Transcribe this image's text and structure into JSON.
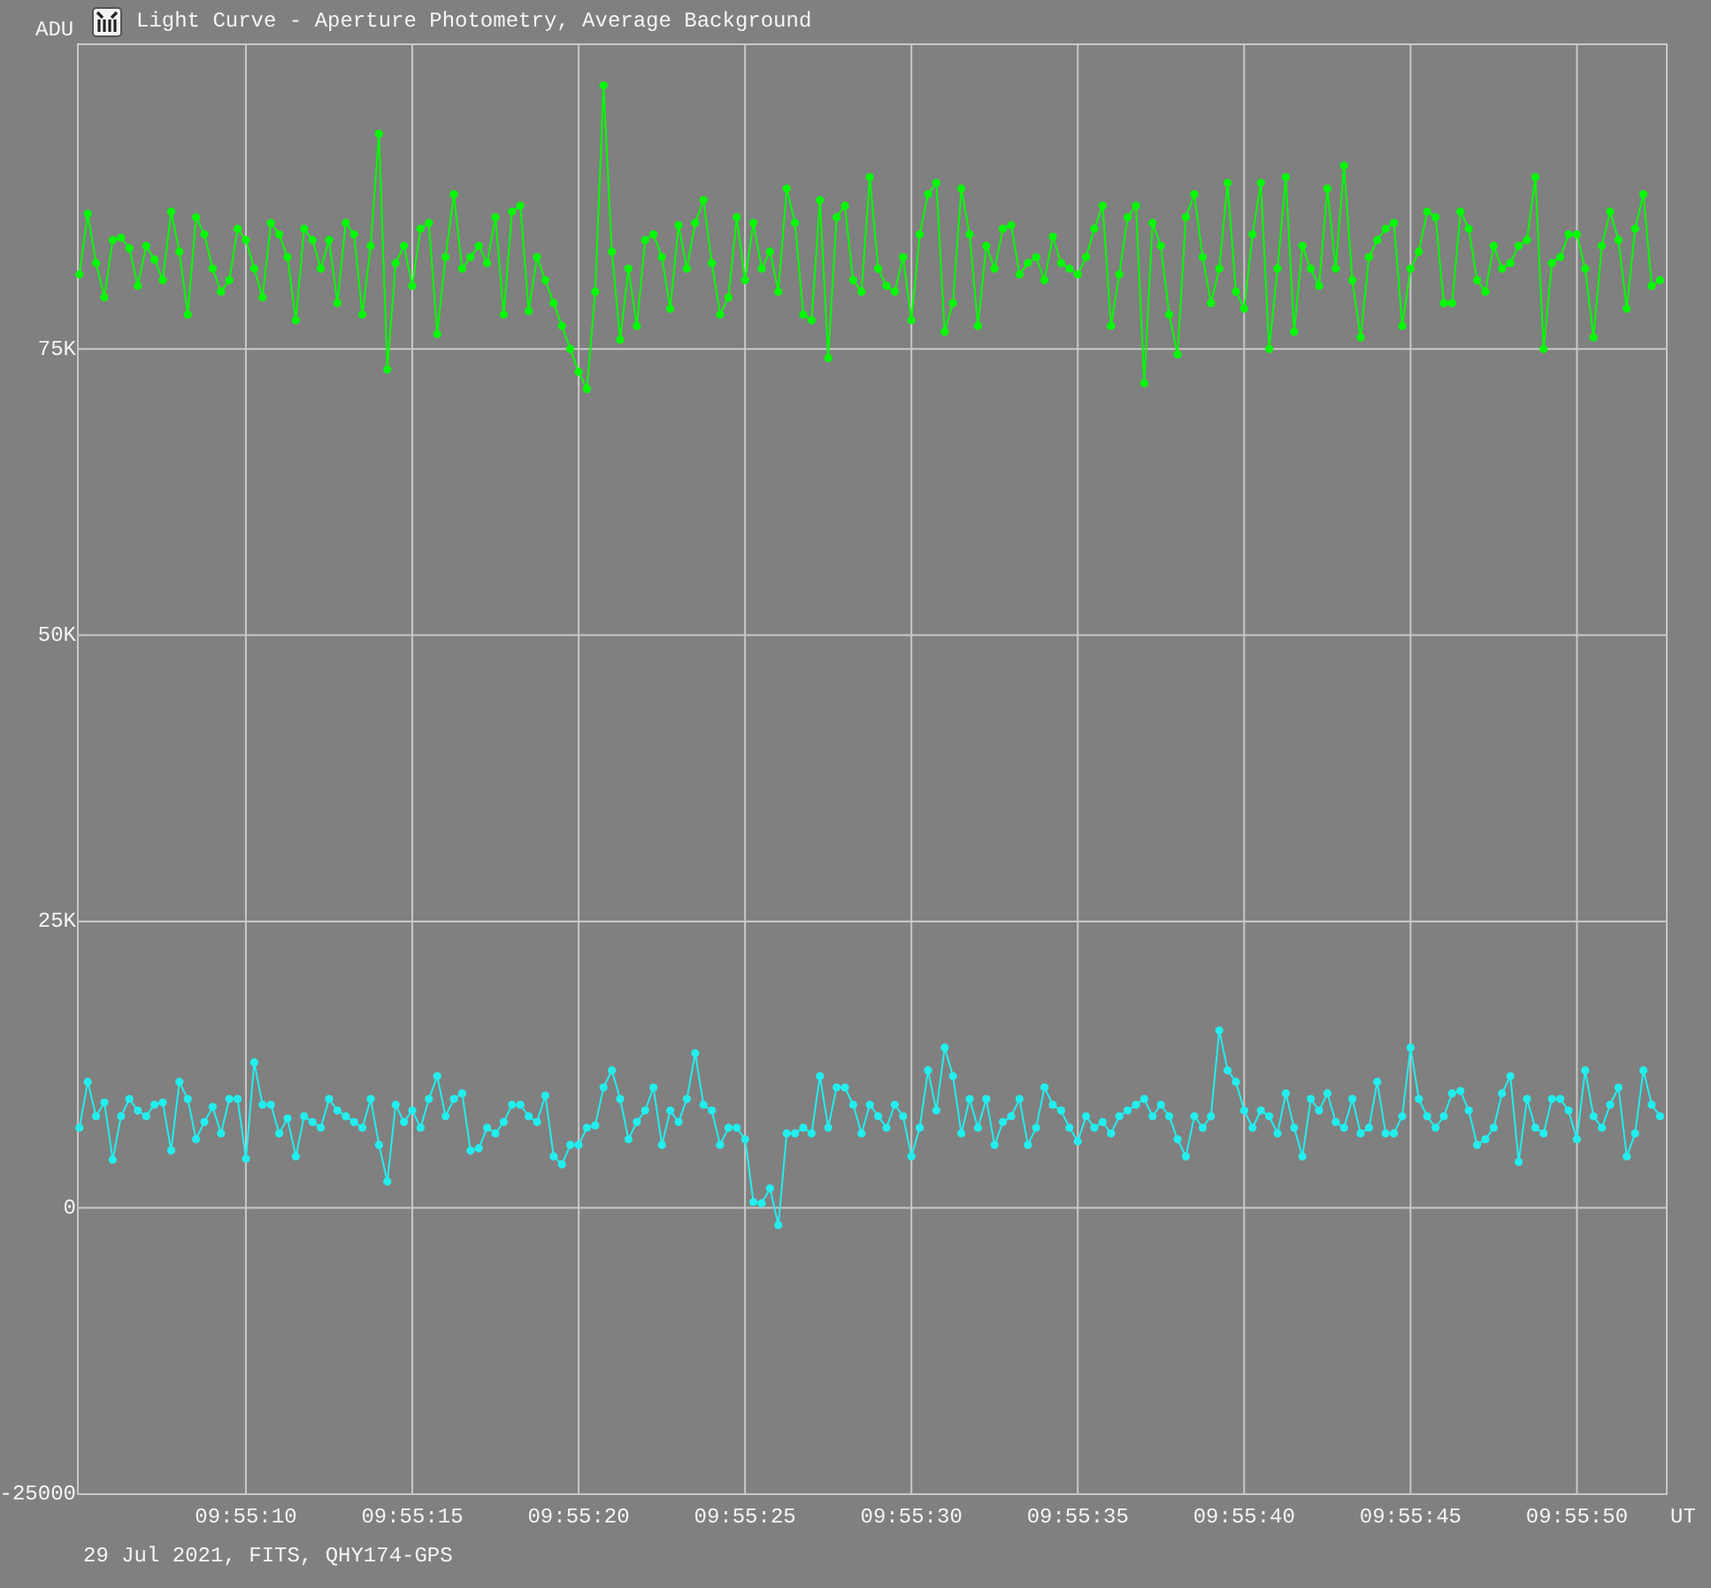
{
  "window": {
    "title": "Light Curve - Aperture Photometry, Average Background"
  },
  "chart": {
    "chart_data": {
      "type": "line",
      "ylabel": "ADU",
      "xlabel": "UT",
      "x": [
        35705,
        35705.25,
        35705.5,
        35705.75,
        35706,
        35706.25,
        35706.5,
        35706.75,
        35707,
        35707.25,
        35707.5,
        35707.75,
        35708,
        35708.25,
        35708.5,
        35708.75,
        35709,
        35709.25,
        35709.5,
        35709.75,
        35710,
        35710.25,
        35710.5,
        35710.75,
        35711,
        35711.25,
        35711.5,
        35711.75,
        35712,
        35712.25,
        35712.5,
        35712.75,
        35713,
        35713.25,
        35713.5,
        35713.75,
        35714,
        35714.25,
        35714.5,
        35714.75,
        35715,
        35715.25,
        35715.5,
        35715.75,
        35716,
        35716.25,
        35716.5,
        35716.75,
        35717,
        35717.25,
        35717.5,
        35717.75,
        35718,
        35718.25,
        35718.5,
        35718.75,
        35719,
        35719.25,
        35719.5,
        35719.75,
        35720,
        35720.25,
        35720.5,
        35720.75,
        35721,
        35721.25,
        35721.5,
        35721.75,
        35722,
        35722.25,
        35722.5,
        35722.75,
        35723,
        35723.25,
        35723.5,
        35723.75,
        35724,
        35724.25,
        35724.5,
        35724.75,
        35725,
        35725.25,
        35725.5,
        35725.75,
        35726,
        35726.25,
        35726.5,
        35726.75,
        35727,
        35727.25,
        35727.5,
        35727.75,
        35728,
        35728.25,
        35728.5,
        35728.75,
        35729,
        35729.25,
        35729.5,
        35729.75,
        35730,
        35730.25,
        35730.5,
        35730.75,
        35731,
        35731.25,
        35731.5,
        35731.75,
        35732,
        35732.25,
        35732.5,
        35732.75,
        35733,
        35733.25,
        35733.5,
        35733.75,
        35734,
        35734.25,
        35734.5,
        35734.75,
        35735,
        35735.25,
        35735.5,
        35735.75,
        35736,
        35736.25,
        35736.5,
        35736.75,
        35737,
        35737.25,
        35737.5,
        35737.75,
        35738,
        35738.25,
        35738.5,
        35738.75,
        35739,
        35739.25,
        35739.5,
        35739.75,
        35740,
        35740.25,
        35740.5,
        35740.75,
        35741,
        35741.25,
        35741.5,
        35741.75,
        35742,
        35742.25,
        35742.5,
        35742.75,
        35743,
        35743.25,
        35743.5,
        35743.75,
        35744,
        35744.25,
        35744.5,
        35744.75,
        35745,
        35745.25,
        35745.5,
        35745.75,
        35746,
        35746.25,
        35746.5,
        35746.75,
        35747,
        35747.25,
        35747.5,
        35747.75,
        35748,
        35748.25,
        35748.5,
        35748.75,
        35749,
        35749.25,
        35749.5,
        35749.75,
        35750,
        35750.25,
        35750.5,
        35750.75,
        35751,
        35751.25,
        35751.5,
        35751.75,
        35752,
        35752.25,
        35752.5
      ],
      "series": [
        {
          "color": "#00ff00",
          "marker": "circle",
          "values": [
            81500,
            86800,
            82500,
            79500,
            84500,
            84700,
            83800,
            80500,
            84000,
            82800,
            81000,
            87000,
            83500,
            78000,
            86500,
            85000,
            82000,
            80000,
            81000,
            85500,
            84500,
            82000,
            79500,
            86000,
            85000,
            83000,
            77500,
            85500,
            84500,
            82000,
            84500,
            79000,
            86000,
            85000,
            78000,
            84000,
            93800,
            73200,
            82500,
            84000,
            80500,
            85500,
            86000,
            76300,
            83000,
            88500,
            82000,
            83000,
            84000,
            82500,
            86500,
            78000,
            87000,
            87500,
            78300,
            83000,
            81000,
            79000,
            77000,
            75000,
            73000,
            71500,
            80000,
            98000,
            83500,
            75800,
            82000,
            77000,
            84500,
            85000,
            83000,
            78500,
            85800,
            82000,
            86000,
            88000,
            82500,
            78000,
            79500,
            86500,
            81000,
            86000,
            82000,
            83500,
            80000,
            89000,
            86000,
            78000,
            77500,
            88000,
            74200,
            86500,
            87500,
            81000,
            80000,
            90000,
            82000,
            80500,
            80000,
            83000,
            77500,
            85000,
            88500,
            89500,
            76500,
            79000,
            89000,
            85000,
            77000,
            84000,
            82000,
            85500,
            85800,
            81500,
            82500,
            83000,
            81000,
            84800,
            82500,
            82000,
            81500,
            83000,
            85500,
            87500,
            77000,
            81500,
            86500,
            87500,
            72000,
            86000,
            84000,
            78000,
            74500,
            86500,
            88500,
            83000,
            79000,
            82000,
            89500,
            80000,
            78500,
            85000,
            89500,
            75000,
            82000,
            90000,
            76500,
            84000,
            82000,
            80500,
            89000,
            82000,
            91000,
            81000,
            76000,
            83000,
            84500,
            85500,
            86000,
            77000,
            82000,
            83500,
            87000,
            86500,
            79000,
            79000,
            87000,
            85500,
            81000,
            80000,
            84000,
            82000,
            82500,
            84000,
            84500,
            90000,
            75000,
            82500,
            83000,
            85000,
            85000,
            82000,
            76000,
            84000,
            87000,
            84500,
            78500,
            85500,
            88500,
            80500,
            81000
          ]
        },
        {
          "color": "#22eeee",
          "marker": "circle",
          "values": [
            7000,
            11000,
            8000,
            9200,
            4200,
            8000,
            9500,
            8500,
            8000,
            9000,
            9200,
            5000,
            11000,
            9500,
            6000,
            7500,
            8800,
            6500,
            9500,
            9500,
            4300,
            12700,
            9000,
            9000,
            6500,
            7800,
            4500,
            8000,
            7500,
            7000,
            9500,
            8500,
            8000,
            7500,
            7000,
            9500,
            5500,
            2300,
            9000,
            7500,
            8500,
            7000,
            9500,
            11500,
            8000,
            9500,
            10000,
            5000,
            5200,
            7000,
            6500,
            7500,
            9000,
            9000,
            8000,
            7500,
            9800,
            4500,
            3800,
            5500,
            5500,
            7000,
            7200,
            10500,
            12000,
            9500,
            6000,
            7500,
            8500,
            10500,
            5500,
            8500,
            7500,
            9500,
            13500,
            9000,
            8500,
            5500,
            7000,
            7000,
            6000,
            500,
            400,
            1700,
            -1500,
            6500,
            6500,
            7000,
            6500,
            11500,
            7000,
            10500,
            10500,
            9000,
            6500,
            9000,
            8000,
            7000,
            9000,
            8000,
            4500,
            7000,
            12000,
            8500,
            14000,
            11500,
            6500,
            9500,
            7000,
            9500,
            5500,
            7500,
            8000,
            9500,
            5500,
            7000,
            10500,
            9000,
            8500,
            7000,
            5800,
            8000,
            7000,
            7500,
            6500,
            8000,
            8500,
            9000,
            9500,
            8000,
            9000,
            8000,
            6000,
            4500,
            8000,
            7000,
            8000,
            15500,
            12000,
            11000,
            8500,
            7000,
            8500,
            8000,
            6500,
            10000,
            7000,
            4500,
            9500,
            8500,
            10000,
            7500,
            7000,
            9500,
            6500,
            7000,
            11000,
            6500,
            6500,
            8000,
            14000,
            9500,
            8000,
            7000,
            8000,
            10000,
            10200,
            8500,
            5500,
            6000,
            7000,
            10000,
            11500,
            4000,
            9500,
            7000,
            6500,
            9500,
            9500,
            8500,
            6000,
            12000,
            8000,
            7000,
            9000,
            10500,
            4500,
            6500,
            12000,
            9000,
            8000
          ]
        }
      ],
      "grid": true,
      "xlim": [
        35704.95,
        35752.7
      ],
      "ylim": [
        -25000,
        101600
      ],
      "xticks": [
        {
          "value": 35710,
          "label": "09:55:10"
        },
        {
          "value": 35715,
          "label": "09:55:15"
        },
        {
          "value": 35720,
          "label": "09:55:20"
        },
        {
          "value": 35725,
          "label": "09:55:25"
        },
        {
          "value": 35730,
          "label": "09:55:30"
        },
        {
          "value": 35735,
          "label": "09:55:35"
        },
        {
          "value": 35740,
          "label": "09:55:40"
        },
        {
          "value": 35745,
          "label": "09:55:45"
        },
        {
          "value": 35750,
          "label": "09:55:50"
        }
      ],
      "yticks": [
        {
          "value": -25000,
          "label": "-25000"
        },
        {
          "value": 0,
          "label": "0"
        },
        {
          "value": 25000,
          "label": "25K"
        },
        {
          "value": 50000,
          "label": "50K"
        },
        {
          "value": 75000,
          "label": "75K"
        }
      ]
    }
  },
  "footer": "29 Jul 2021, FITS, QHY174-GPS"
}
